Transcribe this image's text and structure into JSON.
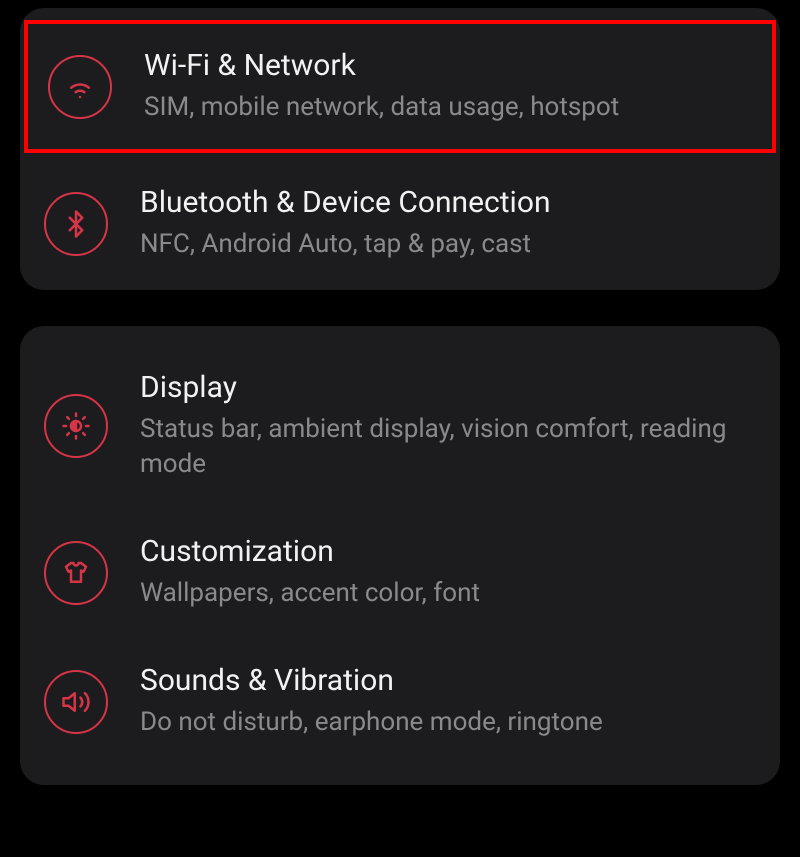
{
  "accent_color": "#d63447",
  "groups": [
    {
      "items": [
        {
          "id": "wifi",
          "title": "Wi-Fi & Network",
          "subtitle": "SIM, mobile network, data usage, hotspot",
          "icon": "wifi-icon",
          "highlighted": true
        },
        {
          "id": "bluetooth",
          "title": "Bluetooth & Device Connection",
          "subtitle": "NFC, Android Auto, tap & pay, cast",
          "icon": "bluetooth-icon",
          "highlighted": false
        }
      ]
    },
    {
      "items": [
        {
          "id": "display",
          "title": "Display",
          "subtitle": "Status bar, ambient display, vision comfort, reading mode",
          "icon": "brightness-icon",
          "highlighted": false
        },
        {
          "id": "customization",
          "title": "Customization",
          "subtitle": "Wallpapers, accent color, font",
          "icon": "tshirt-icon",
          "highlighted": false
        },
        {
          "id": "sounds",
          "title": "Sounds & Vibration",
          "subtitle": "Do not disturb, earphone mode, ringtone",
          "icon": "speaker-icon",
          "highlighted": false
        }
      ]
    }
  ]
}
